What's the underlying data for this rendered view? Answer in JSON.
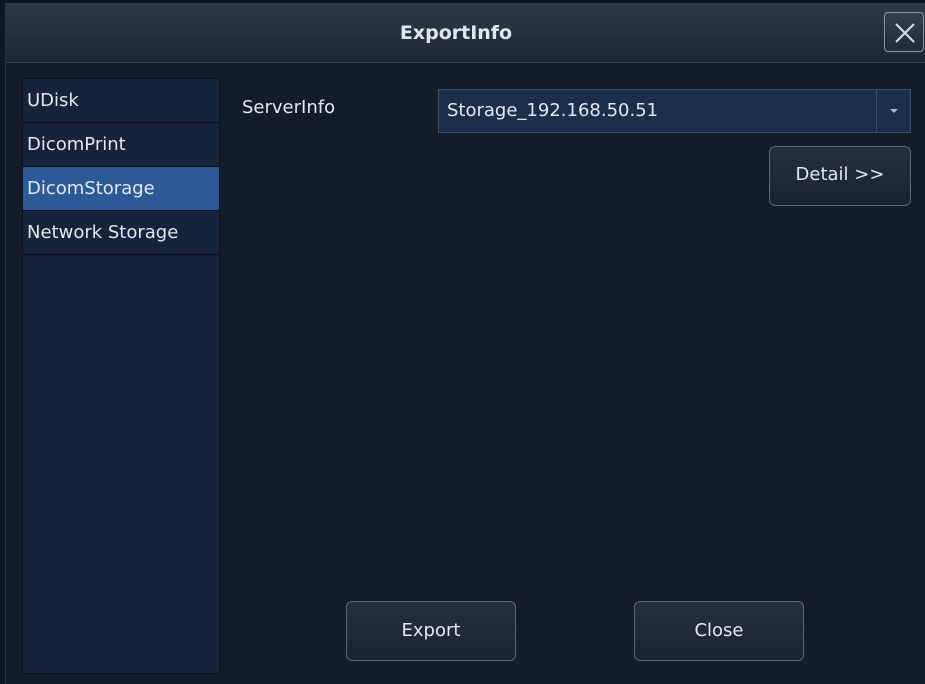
{
  "window": {
    "title": "ExportInfo",
    "close_icon": "close-icon"
  },
  "sidebar": {
    "items": [
      {
        "label": "UDisk",
        "selected": false
      },
      {
        "label": "DicomPrint",
        "selected": false
      },
      {
        "label": "DicomStorage",
        "selected": true
      },
      {
        "label": "Network Storage",
        "selected": false
      }
    ]
  },
  "main": {
    "server_label": "ServerInfo",
    "server_value": "Storage_192.168.50.51",
    "detail_label": "Detail >>",
    "export_label": "Export",
    "close_label": "Close"
  },
  "colors": {
    "background": "#141c2a",
    "selected_item": "#2c5a96",
    "text": "#e3e8ef"
  }
}
